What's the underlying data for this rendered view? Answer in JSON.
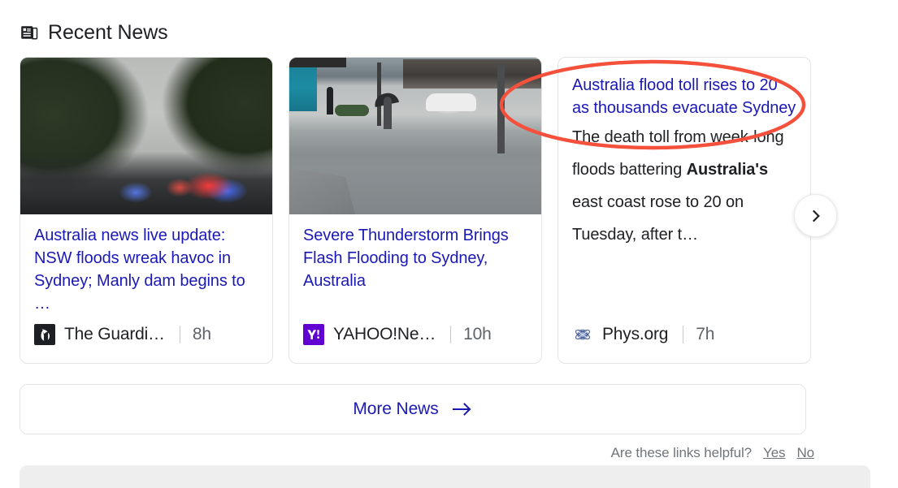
{
  "section": {
    "title": "Recent News",
    "icon": "newspaper-icon"
  },
  "cards": [
    {
      "headline": "Australia news live update: NSW floods wreak havoc in Sydney; Manly dam begins to …",
      "snippet": "",
      "source": "The Guardi…",
      "source_logo": "the-guardian-logo",
      "time": "8h",
      "thumbnail": "flooded-road-with-emergency-vehicles"
    },
    {
      "headline": "Severe Thunderstorm Brings Flash Flooding to Sydney, Australia",
      "snippet": "",
      "source": "YAHOO!Ne…",
      "source_logo": "yahoo-news-logo",
      "time": "10h",
      "thumbnail": "flooded-street-with-pedestrians"
    },
    {
      "headline": "Australia flood toll rises to 20 as thousands evacuate Sydney",
      "snippet_parts": {
        "before": "The death toll from week-long floods battering ",
        "bold": "Australia's",
        "after": " east coast rose to 20 on Tuesday, after t…"
      },
      "source": "Phys.org",
      "source_logo": "phys-org-logo",
      "time": "7h",
      "thumbnail": null
    }
  ],
  "next_button": {
    "icon": "chevron-right-icon",
    "label": "Next"
  },
  "more_news": {
    "label": "More News",
    "icon": "arrow-right-icon"
  },
  "feedback": {
    "question": "Are these links helpful?",
    "yes": "Yes",
    "no": "No"
  },
  "annotation": {
    "shape": "ellipse",
    "color": "#f4503c",
    "target": "third-card-headline"
  },
  "colors": {
    "link_blue": "#1a19b5",
    "text": "#202124",
    "muted": "#70757a",
    "card_border": "#e4e4e4",
    "annotation_red": "#f4503c",
    "bottom_panel": "#eeeeee"
  }
}
